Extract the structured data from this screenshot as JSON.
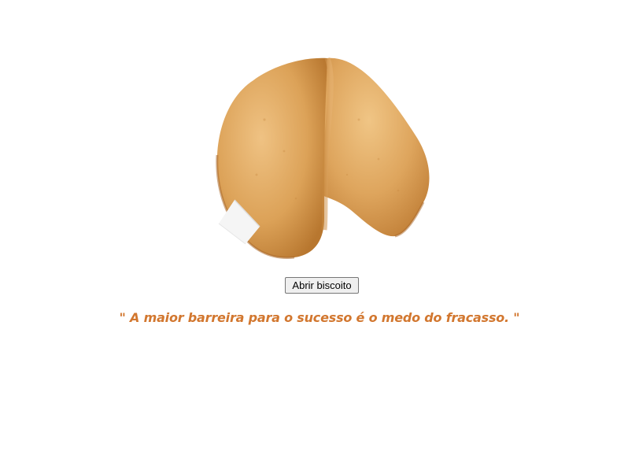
{
  "image": {
    "name": "fortune-cookie"
  },
  "button": {
    "label": "Abrir biscoito"
  },
  "quote": {
    "text": "\" A maior barreira para o sucesso é o medo do fracasso. \"",
    "color": "#d2772f"
  },
  "colors": {
    "cookie_base": "#dba15a",
    "cookie_light": "#eebc7b",
    "cookie_dark": "#b9762f",
    "paper": "#f4f4f4"
  }
}
